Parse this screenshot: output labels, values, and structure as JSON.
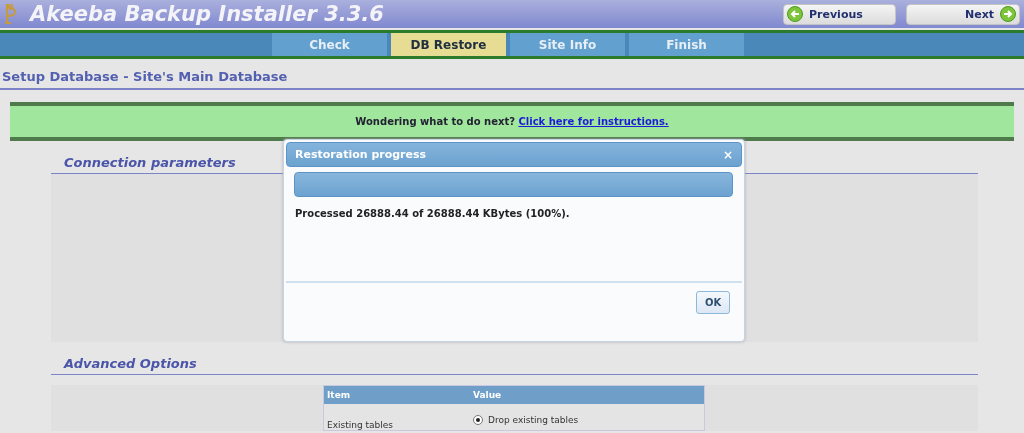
{
  "header": {
    "title": "Akeeba Backup Installer 3.3.6",
    "buttons": [
      {
        "kind": "previous",
        "label": "Previous"
      },
      {
        "kind": "next",
        "label": "Next"
      }
    ]
  },
  "tabs": [
    {
      "label": "Check",
      "selected": false
    },
    {
      "label": "DB Restore",
      "selected": true
    },
    {
      "label": "Site Info",
      "selected": false
    },
    {
      "label": "Finish",
      "selected": false
    }
  ],
  "page_title": "Setup Database - Site's Main Database",
  "notice": {
    "text": "Wondering what to do next?",
    "link": "Click here for instructions."
  },
  "sections": [
    {
      "title": "Connection parameters"
    },
    {
      "title": "Advanced Options"
    }
  ],
  "options_table": {
    "columns": [
      "Item",
      "Value"
    ],
    "rows": [
      {
        "item": "Existing tables",
        "options": [
          {
            "label": "Drop existing tables",
            "selected": true
          }
        ]
      }
    ]
  },
  "dialog": {
    "title": "Restoration progress",
    "close": "×",
    "message": "Processed 26888.44 of 26888.44 KBytes (100%).",
    "buttons": [
      "OK"
    ]
  }
}
